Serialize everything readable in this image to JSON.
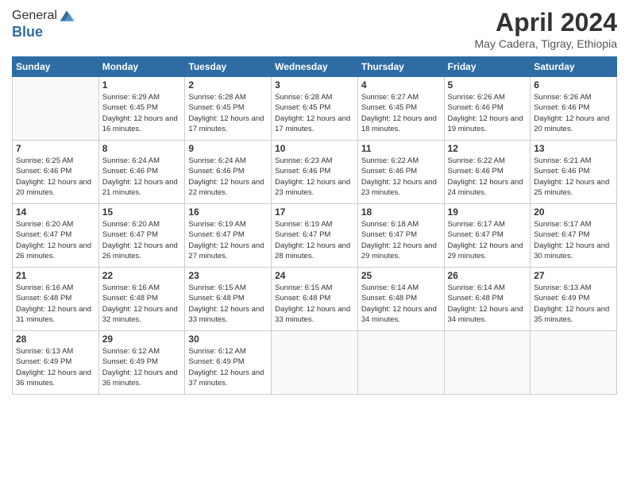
{
  "logo": {
    "general": "General",
    "blue": "Blue"
  },
  "title": "April 2024",
  "subtitle": "May Cadera, Tigray, Ethiopia",
  "weekdays": [
    "Sunday",
    "Monday",
    "Tuesday",
    "Wednesday",
    "Thursday",
    "Friday",
    "Saturday"
  ],
  "weeks": [
    [
      {
        "day": "",
        "sunrise": "",
        "sunset": "",
        "daylight": ""
      },
      {
        "day": "1",
        "sunrise": "Sunrise: 6:29 AM",
        "sunset": "Sunset: 6:45 PM",
        "daylight": "Daylight: 12 hours and 16 minutes."
      },
      {
        "day": "2",
        "sunrise": "Sunrise: 6:28 AM",
        "sunset": "Sunset: 6:45 PM",
        "daylight": "Daylight: 12 hours and 17 minutes."
      },
      {
        "day": "3",
        "sunrise": "Sunrise: 6:28 AM",
        "sunset": "Sunset: 6:45 PM",
        "daylight": "Daylight: 12 hours and 17 minutes."
      },
      {
        "day": "4",
        "sunrise": "Sunrise: 6:27 AM",
        "sunset": "Sunset: 6:45 PM",
        "daylight": "Daylight: 12 hours and 18 minutes."
      },
      {
        "day": "5",
        "sunrise": "Sunrise: 6:26 AM",
        "sunset": "Sunset: 6:46 PM",
        "daylight": "Daylight: 12 hours and 19 minutes."
      },
      {
        "day": "6",
        "sunrise": "Sunrise: 6:26 AM",
        "sunset": "Sunset: 6:46 PM",
        "daylight": "Daylight: 12 hours and 20 minutes."
      }
    ],
    [
      {
        "day": "7",
        "sunrise": "Sunrise: 6:25 AM",
        "sunset": "Sunset: 6:46 PM",
        "daylight": "Daylight: 12 hours and 20 minutes."
      },
      {
        "day": "8",
        "sunrise": "Sunrise: 6:24 AM",
        "sunset": "Sunset: 6:46 PM",
        "daylight": "Daylight: 12 hours and 21 minutes."
      },
      {
        "day": "9",
        "sunrise": "Sunrise: 6:24 AM",
        "sunset": "Sunset: 6:46 PM",
        "daylight": "Daylight: 12 hours and 22 minutes."
      },
      {
        "day": "10",
        "sunrise": "Sunrise: 6:23 AM",
        "sunset": "Sunset: 6:46 PM",
        "daylight": "Daylight: 12 hours and 23 minutes."
      },
      {
        "day": "11",
        "sunrise": "Sunrise: 6:22 AM",
        "sunset": "Sunset: 6:46 PM",
        "daylight": "Daylight: 12 hours and 23 minutes."
      },
      {
        "day": "12",
        "sunrise": "Sunrise: 6:22 AM",
        "sunset": "Sunset: 6:46 PM",
        "daylight": "Daylight: 12 hours and 24 minutes."
      },
      {
        "day": "13",
        "sunrise": "Sunrise: 6:21 AM",
        "sunset": "Sunset: 6:46 PM",
        "daylight": "Daylight: 12 hours and 25 minutes."
      }
    ],
    [
      {
        "day": "14",
        "sunrise": "Sunrise: 6:20 AM",
        "sunset": "Sunset: 6:47 PM",
        "daylight": "Daylight: 12 hours and 26 minutes."
      },
      {
        "day": "15",
        "sunrise": "Sunrise: 6:20 AM",
        "sunset": "Sunset: 6:47 PM",
        "daylight": "Daylight: 12 hours and 26 minutes."
      },
      {
        "day": "16",
        "sunrise": "Sunrise: 6:19 AM",
        "sunset": "Sunset: 6:47 PM",
        "daylight": "Daylight: 12 hours and 27 minutes."
      },
      {
        "day": "17",
        "sunrise": "Sunrise: 6:19 AM",
        "sunset": "Sunset: 6:47 PM",
        "daylight": "Daylight: 12 hours and 28 minutes."
      },
      {
        "day": "18",
        "sunrise": "Sunrise: 6:18 AM",
        "sunset": "Sunset: 6:47 PM",
        "daylight": "Daylight: 12 hours and 29 minutes."
      },
      {
        "day": "19",
        "sunrise": "Sunrise: 6:17 AM",
        "sunset": "Sunset: 6:47 PM",
        "daylight": "Daylight: 12 hours and 29 minutes."
      },
      {
        "day": "20",
        "sunrise": "Sunrise: 6:17 AM",
        "sunset": "Sunset: 6:47 PM",
        "daylight": "Daylight: 12 hours and 30 minutes."
      }
    ],
    [
      {
        "day": "21",
        "sunrise": "Sunrise: 6:16 AM",
        "sunset": "Sunset: 6:48 PM",
        "daylight": "Daylight: 12 hours and 31 minutes."
      },
      {
        "day": "22",
        "sunrise": "Sunrise: 6:16 AM",
        "sunset": "Sunset: 6:48 PM",
        "daylight": "Daylight: 12 hours and 32 minutes."
      },
      {
        "day": "23",
        "sunrise": "Sunrise: 6:15 AM",
        "sunset": "Sunset: 6:48 PM",
        "daylight": "Daylight: 12 hours and 33 minutes."
      },
      {
        "day": "24",
        "sunrise": "Sunrise: 6:15 AM",
        "sunset": "Sunset: 6:48 PM",
        "daylight": "Daylight: 12 hours and 33 minutes."
      },
      {
        "day": "25",
        "sunrise": "Sunrise: 6:14 AM",
        "sunset": "Sunset: 6:48 PM",
        "daylight": "Daylight: 12 hours and 34 minutes."
      },
      {
        "day": "26",
        "sunrise": "Sunrise: 6:14 AM",
        "sunset": "Sunset: 6:48 PM",
        "daylight": "Daylight: 12 hours and 34 minutes."
      },
      {
        "day": "27",
        "sunrise": "Sunrise: 6:13 AM",
        "sunset": "Sunset: 6:49 PM",
        "daylight": "Daylight: 12 hours and 35 minutes."
      }
    ],
    [
      {
        "day": "28",
        "sunrise": "Sunrise: 6:13 AM",
        "sunset": "Sunset: 6:49 PM",
        "daylight": "Daylight: 12 hours and 36 minutes."
      },
      {
        "day": "29",
        "sunrise": "Sunrise: 6:12 AM",
        "sunset": "Sunset: 6:49 PM",
        "daylight": "Daylight: 12 hours and 36 minutes."
      },
      {
        "day": "30",
        "sunrise": "Sunrise: 6:12 AM",
        "sunset": "Sunset: 6:49 PM",
        "daylight": "Daylight: 12 hours and 37 minutes."
      },
      {
        "day": "",
        "sunrise": "",
        "sunset": "",
        "daylight": ""
      },
      {
        "day": "",
        "sunrise": "",
        "sunset": "",
        "daylight": ""
      },
      {
        "day": "",
        "sunrise": "",
        "sunset": "",
        "daylight": ""
      },
      {
        "day": "",
        "sunrise": "",
        "sunset": "",
        "daylight": ""
      }
    ]
  ]
}
